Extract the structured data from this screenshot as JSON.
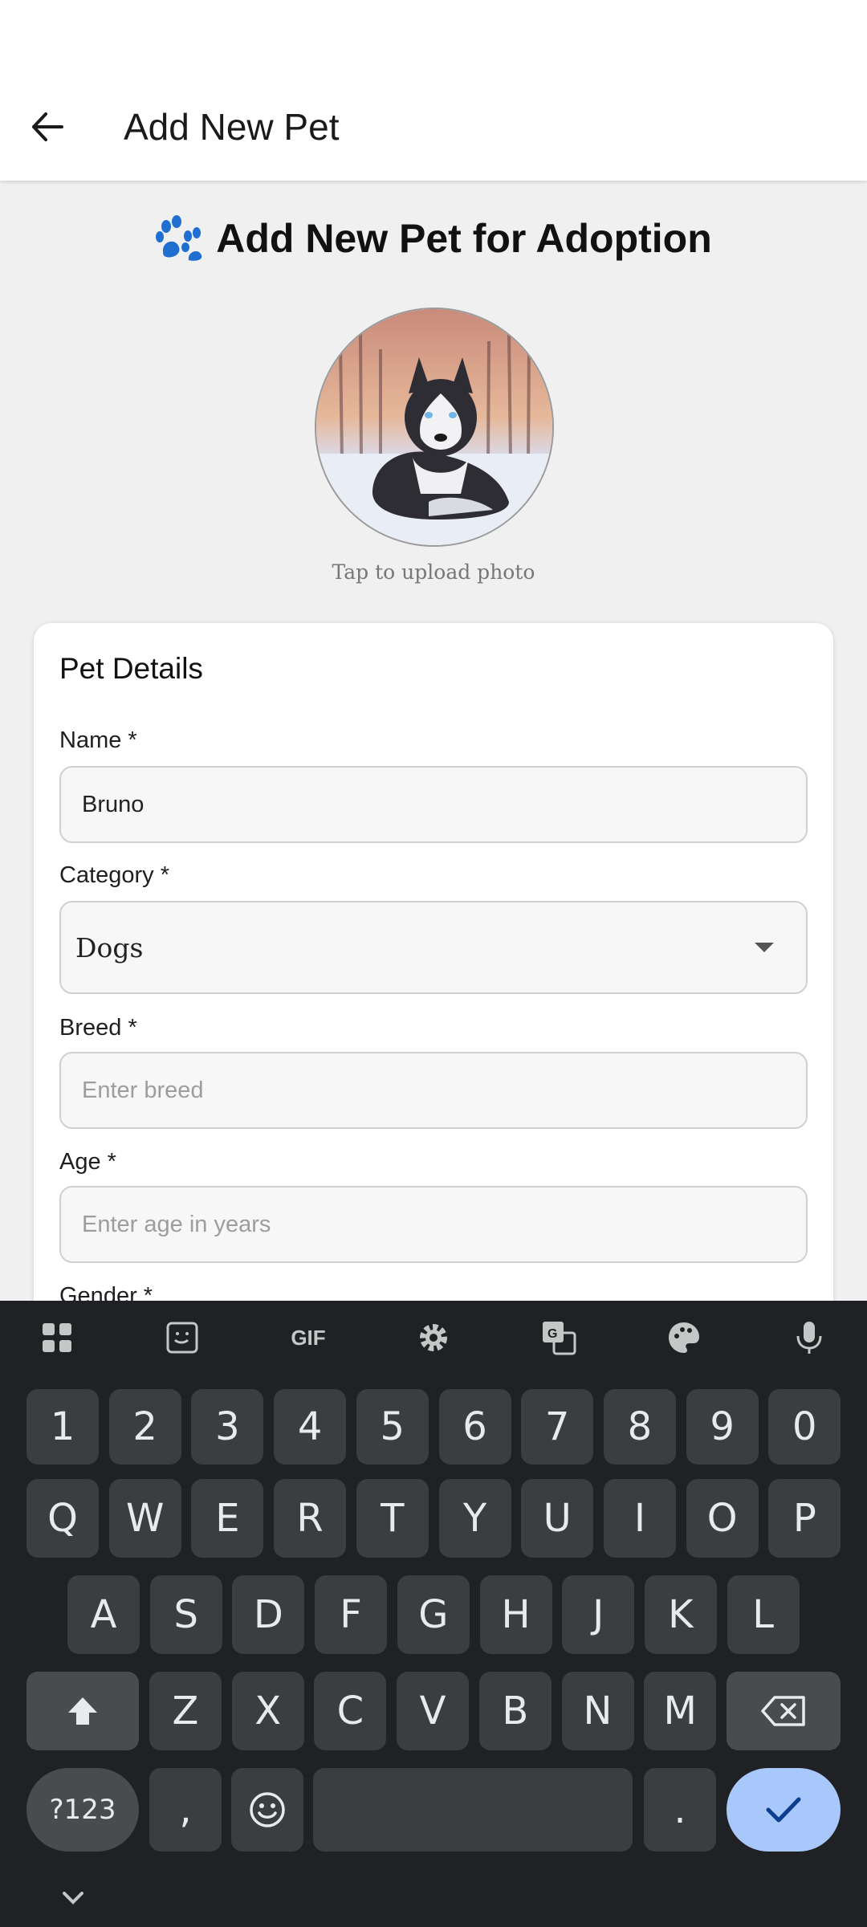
{
  "app_bar": {
    "title": "Add New Pet"
  },
  "heading": {
    "text": "Add New Pet for Adoption",
    "icon": "paw-icon"
  },
  "photo": {
    "hint": "Tap to upload photo",
    "image_desc": "husky-dog-photo"
  },
  "card": {
    "title": "Pet Details",
    "name": {
      "label": "Name *",
      "value": "Bruno"
    },
    "category": {
      "label": "Category *",
      "value": "Dogs"
    },
    "breed": {
      "label": "Breed *",
      "placeholder": "Enter breed"
    },
    "age": {
      "label": "Age *",
      "placeholder": "Enter age in years"
    },
    "gender": {
      "label": "Gender *"
    }
  },
  "keyboard": {
    "row_numbers": [
      "1",
      "2",
      "3",
      "4",
      "5",
      "6",
      "7",
      "8",
      "9",
      "0"
    ],
    "row_q": [
      "Q",
      "W",
      "E",
      "R",
      "T",
      "Y",
      "U",
      "I",
      "O",
      "P"
    ],
    "row_a": [
      "A",
      "S",
      "D",
      "F",
      "G",
      "H",
      "J",
      "K",
      "L"
    ],
    "row_z": [
      "Z",
      "X",
      "C",
      "V",
      "B",
      "N",
      "M"
    ],
    "symbols_label": "?123",
    "comma": ",",
    "period": ".",
    "gif_label": "GIF"
  },
  "colors": {
    "keyboard_bg": "#202124",
    "key_bg": "#3c3d40",
    "action_key": "#a8c7fa"
  }
}
